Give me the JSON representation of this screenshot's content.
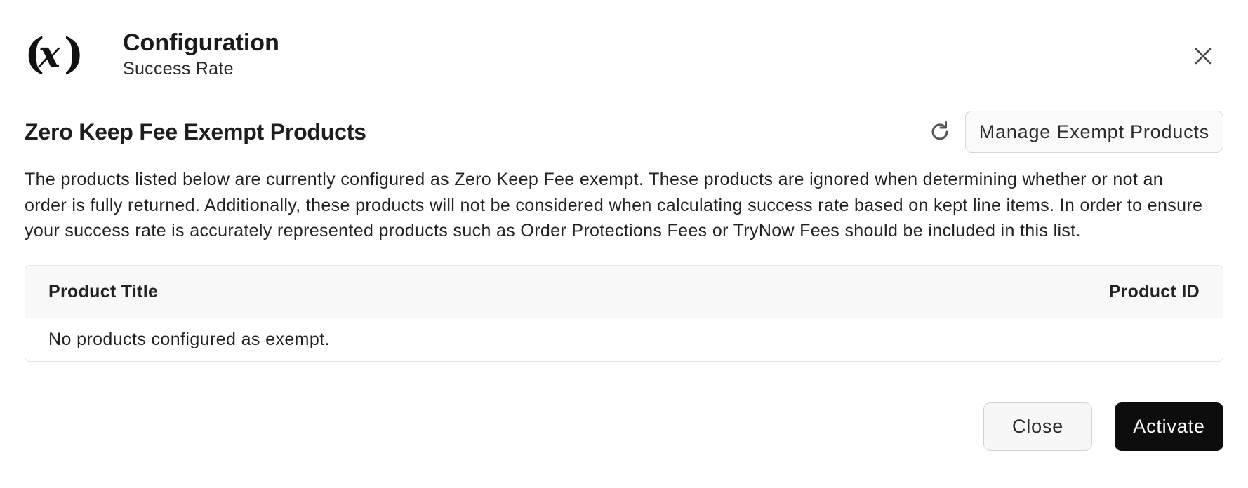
{
  "header": {
    "logo_text": "(x)",
    "title": "Configuration",
    "subtitle": "Success Rate",
    "close_icon": "close-icon"
  },
  "section": {
    "title": "Zero Keep Fee Exempt Products",
    "refresh_icon": "refresh-icon",
    "manage_button_label": "Manage Exempt Products",
    "description": "The products listed below are currently configured as Zero Keep Fee exempt. These products are ignored when determining whether or not an order is fully returned. Additionally, these products will not be considered when calculating success rate based on kept line items. In order to ensure your success rate is accurately represented products such as Order Protections Fees or TryNow Fees should be included in this list."
  },
  "table": {
    "columns": [
      "Product Title",
      "Product ID"
    ],
    "rows": [],
    "empty_message": "No products configured as exempt."
  },
  "footer": {
    "close_label": "Close",
    "activate_label": "Activate"
  },
  "colors": {
    "primary_button": "#0d0d0d",
    "border": "#e2e2e2",
    "table_header_bg": "#f8f8f8"
  }
}
